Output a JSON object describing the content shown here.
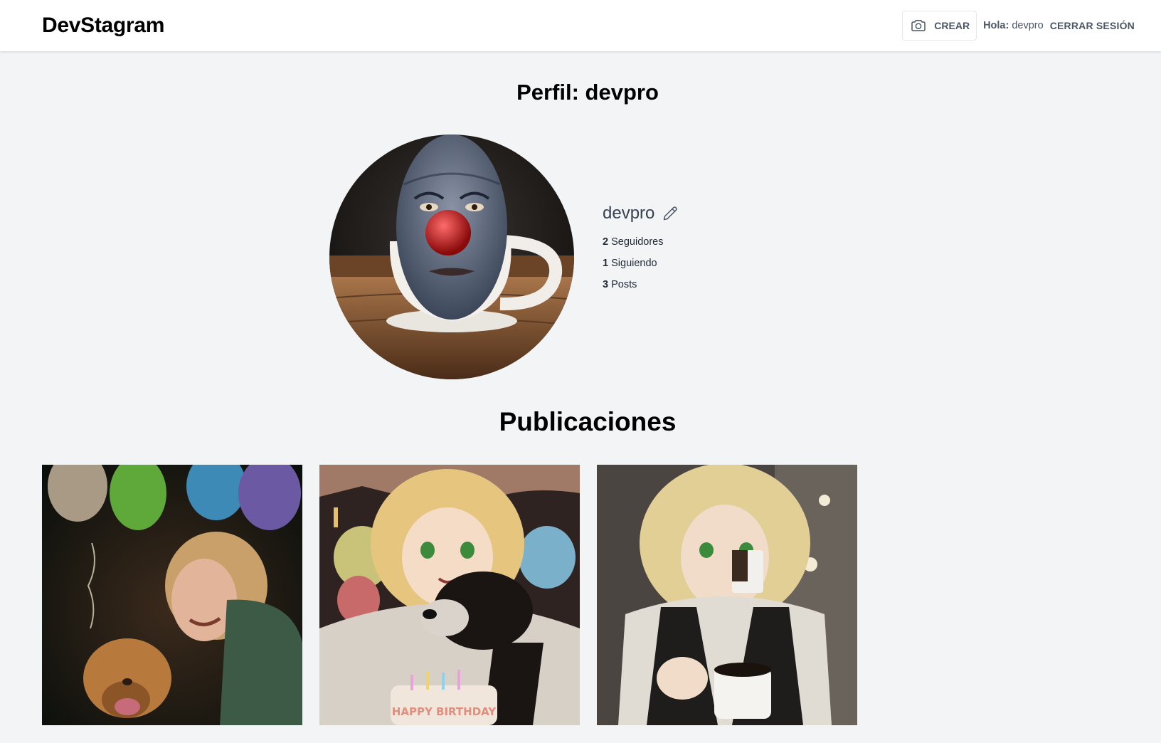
{
  "header": {
    "logo": "DevStagram",
    "create_label": "CREAR",
    "greeting_label": "Hola:",
    "greeting_user": "devpro",
    "logout_label": "CERRAR SESIÓN"
  },
  "profile": {
    "title": "Perfil: devpro",
    "username": "devpro",
    "followers_count": "2",
    "followers_label": "Seguidores",
    "following_count": "1",
    "following_label": "Siguiendo",
    "posts_count": "3",
    "posts_label": "Posts"
  },
  "posts_section": {
    "title": "Publicaciones"
  },
  "post_overlay_text": "HAPPY BIRTHDAY",
  "icons": {
    "create": "camera-icon",
    "edit": "pencil-icon"
  },
  "colors": {
    "page_bg": "#f3f4f6",
    "header_bg": "#ffffff",
    "text_muted": "#4b5563"
  }
}
